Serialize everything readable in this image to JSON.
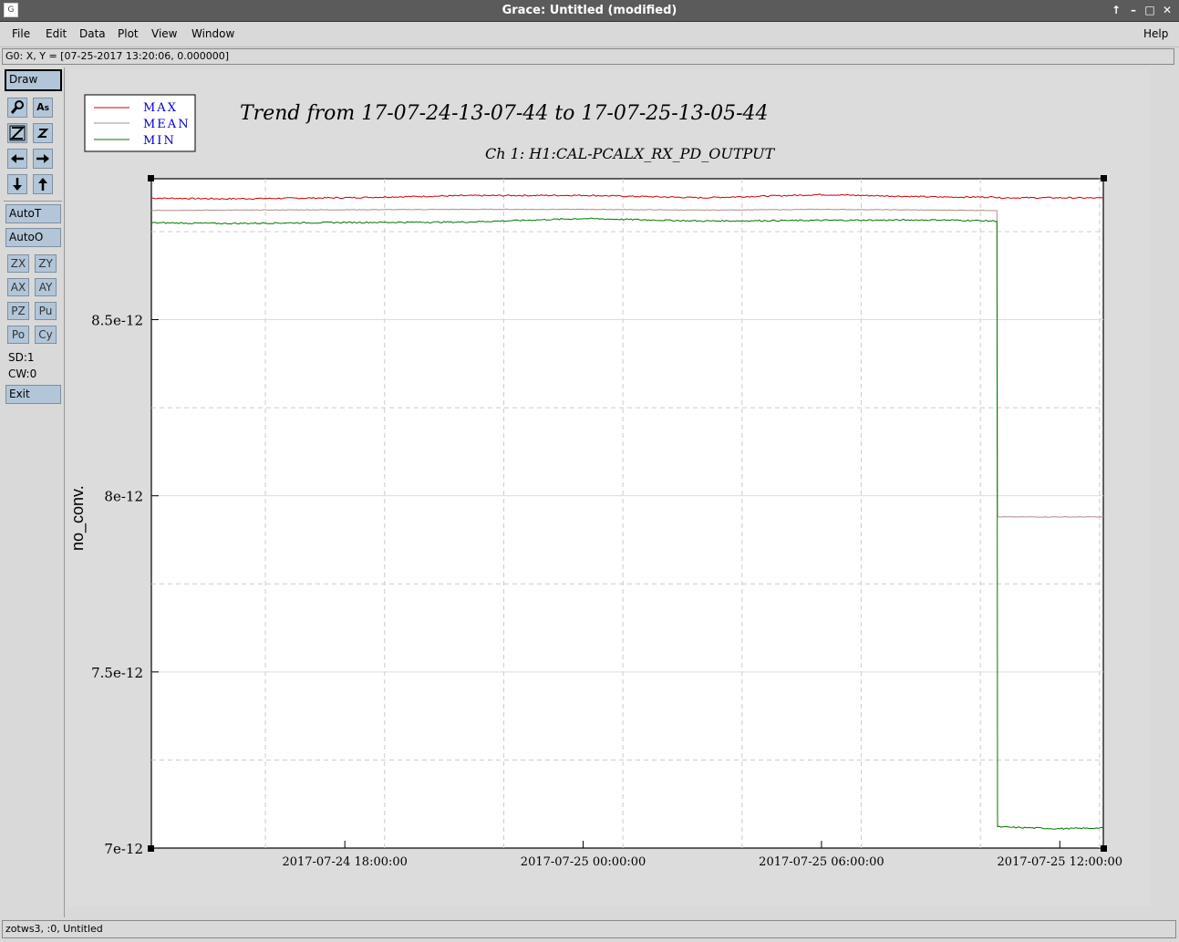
{
  "window": {
    "title": "Grace: Untitled (modified)",
    "app_icon": "grace-app-icon",
    "controls": [
      "↑",
      "–",
      "□",
      "✕"
    ]
  },
  "menu": {
    "items": [
      "File",
      "Edit",
      "Data",
      "Plot",
      "View",
      "Window"
    ],
    "help": "Help"
  },
  "locator": {
    "text": "G0: X, Y = [07-25-2017 13:20:06, 0.000000]"
  },
  "toolbar": {
    "draw": "Draw",
    "icons": [
      "zoom-icon",
      "text-icon",
      "zoom-z-icon",
      "zoom-z-small-icon",
      "arrow-left-icon",
      "arrow-right-icon",
      "arrow-down-icon",
      "arrow-up-icon"
    ],
    "autot": "AutoT",
    "autoo": "AutoO",
    "small_buttons": [
      "ZX",
      "ZY",
      "AX",
      "AY",
      "PZ",
      "Pu",
      "Po",
      "Cy"
    ],
    "sd": "SD:1",
    "cw": "CW:0",
    "exit": "Exit"
  },
  "status": {
    "text": "zotws3, :0, Untitled"
  },
  "colors": {
    "max": "#cc0000",
    "mean": "#b08a8a",
    "min": "#007700",
    "legend_text": "#0000cc",
    "button": "#b3c6d9"
  },
  "chart_data": {
    "type": "line",
    "title": "Trend from 17-07-24-13-07-44 to 17-07-25-13-05-44",
    "subtitle": "Ch 1: H1:CAL-PCALX_RX_PD_OUTPUT",
    "ylabel": "no_conv.",
    "xlabel": "",
    "xlim": [
      "2017-07-24 13:07:44",
      "2017-07-25 13:05:44"
    ],
    "ylim": [
      7e-12,
      8.9e-12
    ],
    "yticks": [
      "7e-12",
      "7.5e-12",
      "8e-12",
      "8.5e-12"
    ],
    "xticks": [
      "2017-07-24 18:00:00",
      "2017-07-25 00:00:00",
      "2017-07-25 06:00:00",
      "2017-07-25 12:00:00"
    ],
    "grid": true,
    "legend_position": "top-left",
    "x": [
      "2017-07-24 13:07:44",
      "2017-07-24 15:00:00",
      "2017-07-24 18:00:00",
      "2017-07-24 21:00:00",
      "2017-07-25 00:00:00",
      "2017-07-25 03:00:00",
      "2017-07-25 06:00:00",
      "2017-07-25 09:00:00",
      "2017-07-25 10:25:00",
      "2017-07-25 10:26:00",
      "2017-07-25 12:00:00",
      "2017-07-25 13:05:44"
    ],
    "series": [
      {
        "name": "MAX",
        "values": [
          8.845e-12,
          8.843e-12,
          8.846e-12,
          8.852e-12,
          8.853e-12,
          8.846e-12,
          8.855e-12,
          8.848e-12,
          8.848e-12,
          8.846e-12,
          8.846e-12,
          8.845e-12
        ]
      },
      {
        "name": "MEAN",
        "values": [
          8.81e-12,
          8.811e-12,
          8.812e-12,
          8.813e-12,
          8.813e-12,
          8.811e-12,
          8.813e-12,
          8.811e-12,
          8.81e-12,
          7.94e-12,
          7.94e-12,
          7.94e-12
        ]
      },
      {
        "name": "MIN",
        "values": [
          8.775e-12,
          8.773e-12,
          8.776e-12,
          8.777e-12,
          8.787e-12,
          8.78e-12,
          8.782e-12,
          8.783e-12,
          8.78e-12,
          7.06e-12,
          7.055e-12,
          7.057e-12
        ]
      }
    ]
  }
}
